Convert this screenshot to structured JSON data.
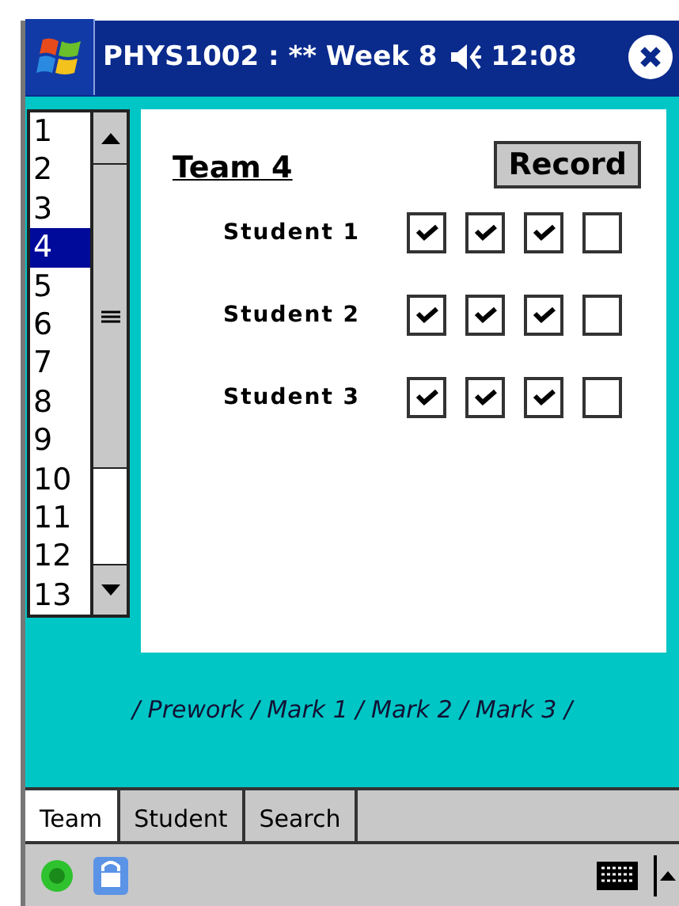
{
  "title_bar": {
    "title": "PHYS1002 : ** Week 8",
    "time": "12:08"
  },
  "team_list": [
    {
      "label": "1",
      "selected": false
    },
    {
      "label": "2",
      "selected": false
    },
    {
      "label": "3",
      "selected": false
    },
    {
      "label": "4",
      "selected": true
    },
    {
      "label": "5",
      "selected": false
    },
    {
      "label": "6",
      "selected": false
    },
    {
      "label": "7",
      "selected": false
    },
    {
      "label": "8",
      "selected": false
    },
    {
      "label": "9",
      "selected": false
    },
    {
      "label": "10",
      "selected": false
    },
    {
      "label": "11",
      "selected": false
    },
    {
      "label": "12",
      "selected": false
    },
    {
      "label": "13",
      "selected": false
    }
  ],
  "panel": {
    "heading": "Team 4",
    "record_button": "Record",
    "students": [
      {
        "name": "Student 1",
        "marks": [
          {
            "checked": true
          },
          {
            "checked": true
          },
          {
            "checked": true
          },
          {
            "checked": false
          }
        ]
      },
      {
        "name": "Student 2",
        "marks": [
          {
            "checked": true
          },
          {
            "checked": true
          },
          {
            "checked": true
          },
          {
            "checked": false
          }
        ]
      },
      {
        "name": "Student 3",
        "marks": [
          {
            "checked": true
          },
          {
            "checked": true
          },
          {
            "checked": true
          },
          {
            "checked": false
          }
        ]
      }
    ]
  },
  "legend": "/ Prework / Mark 1 / Mark 2 / Mark 3 /",
  "tabs": [
    {
      "label": "Team",
      "selected": true
    },
    {
      "label": "Student",
      "selected": false
    },
    {
      "label": "Search",
      "selected": false
    }
  ]
}
